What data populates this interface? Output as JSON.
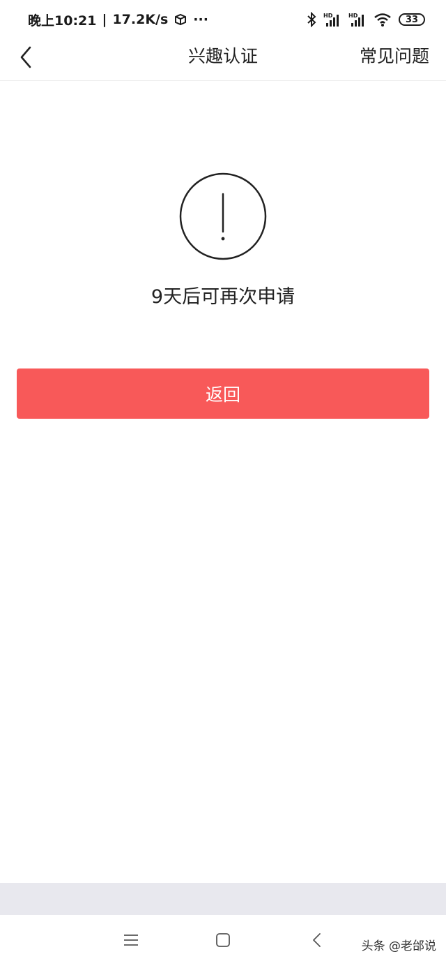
{
  "status_bar": {
    "time": "晚上10:21",
    "separator": "|",
    "net_speed": "17.2K/s",
    "more": "···",
    "icons": [
      "package-icon",
      "bluetooth-icon",
      "signal-hd-1-icon",
      "signal-hd-2-icon",
      "wifi-icon"
    ],
    "battery_level": "33"
  },
  "nav": {
    "back_icon": "chevron-left-icon",
    "title": "兴趣认证",
    "faq": "常见问题"
  },
  "content": {
    "alert_icon": "exclamation-circle-icon",
    "message": "9天后可再次申请",
    "return_button": "返回"
  },
  "colors": {
    "accent": "#f85959",
    "strip": "#e8e8ee"
  },
  "system_nav": {
    "icons": [
      "menu-icon",
      "home-icon",
      "back-icon"
    ]
  },
  "watermark": "头条 @老邰说"
}
